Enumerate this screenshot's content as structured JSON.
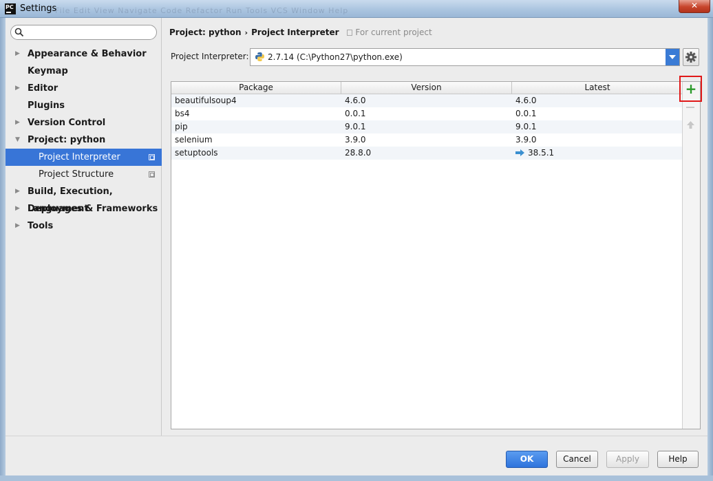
{
  "window": {
    "title": "Settings",
    "app_badge": "PC",
    "close_glyph": "✕",
    "background_menu_ghost": "File  Edit  View  Navigate  Code  Refactor  Run  Tools  VCS  Window  Help"
  },
  "sidebar": {
    "search": {
      "value": "",
      "placeholder": ""
    },
    "items": [
      {
        "label": "Appearance & Behavior",
        "expandable": true,
        "expanded": false,
        "level": 0
      },
      {
        "label": "Keymap",
        "expandable": false,
        "level": 0
      },
      {
        "label": "Editor",
        "expandable": true,
        "expanded": false,
        "level": 0
      },
      {
        "label": "Plugins",
        "expandable": false,
        "level": 0
      },
      {
        "label": "Version Control",
        "expandable": true,
        "expanded": false,
        "level": 0
      },
      {
        "label": "Project: python",
        "expandable": true,
        "expanded": true,
        "level": 0
      },
      {
        "label": "Project Interpreter",
        "level": 1,
        "selected": true
      },
      {
        "label": "Project Structure",
        "level": 1
      },
      {
        "label": "Build, Execution, Deployment",
        "expandable": true,
        "expanded": false,
        "level": 0
      },
      {
        "label": "Languages & Frameworks",
        "expandable": true,
        "expanded": false,
        "level": 0
      },
      {
        "label": "Tools",
        "expandable": true,
        "expanded": false,
        "level": 0
      }
    ]
  },
  "breadcrumb": {
    "parent": "Project: python",
    "separator": "›",
    "current": "Project Interpreter",
    "scope_note": "For current project"
  },
  "interpreter": {
    "label": "Project Interpreter:",
    "value": "2.7.14 (C:\\Python27\\python.exe)"
  },
  "packages": {
    "columns": [
      "Package",
      "Version",
      "Latest"
    ],
    "rows": [
      {
        "package": "beautifulsoup4",
        "version": "4.6.0",
        "latest": "4.6.0",
        "upgrade": false
      },
      {
        "package": "bs4",
        "version": "0.0.1",
        "latest": "0.0.1",
        "upgrade": false
      },
      {
        "package": "pip",
        "version": "9.0.1",
        "latest": "9.0.1",
        "upgrade": false
      },
      {
        "package": "selenium",
        "version": "3.9.0",
        "latest": "3.9.0",
        "upgrade": false
      },
      {
        "package": "setuptools",
        "version": "28.8.0",
        "latest": "38.5.1",
        "upgrade": true
      }
    ],
    "toolbar": {
      "add": "+",
      "remove": "—",
      "upgrade": "↑"
    }
  },
  "colors": {
    "selection": "#3875d7",
    "highlight_box": "#e01818",
    "add_icon": "#2a9a2a",
    "upgrade_arrow": "#3a8fd0"
  },
  "footer": {
    "ok": "OK",
    "cancel": "Cancel",
    "apply": "Apply",
    "help": "Help"
  }
}
